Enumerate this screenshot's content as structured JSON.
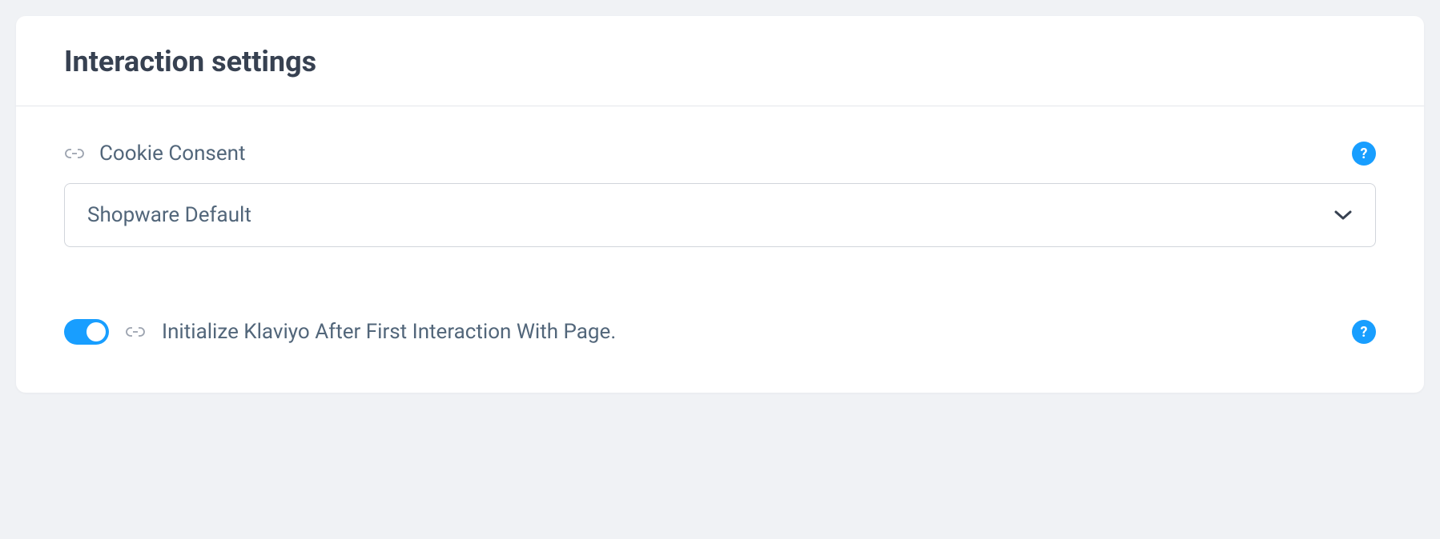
{
  "card": {
    "title": "Interaction settings"
  },
  "fields": {
    "cookieConsent": {
      "label": "Cookie Consent",
      "value": "Shopware Default"
    },
    "initKlaviyo": {
      "label": "Initialize Klaviyo After First Interaction With Page.",
      "enabled": true
    }
  },
  "colors": {
    "accent": "#189eff"
  }
}
